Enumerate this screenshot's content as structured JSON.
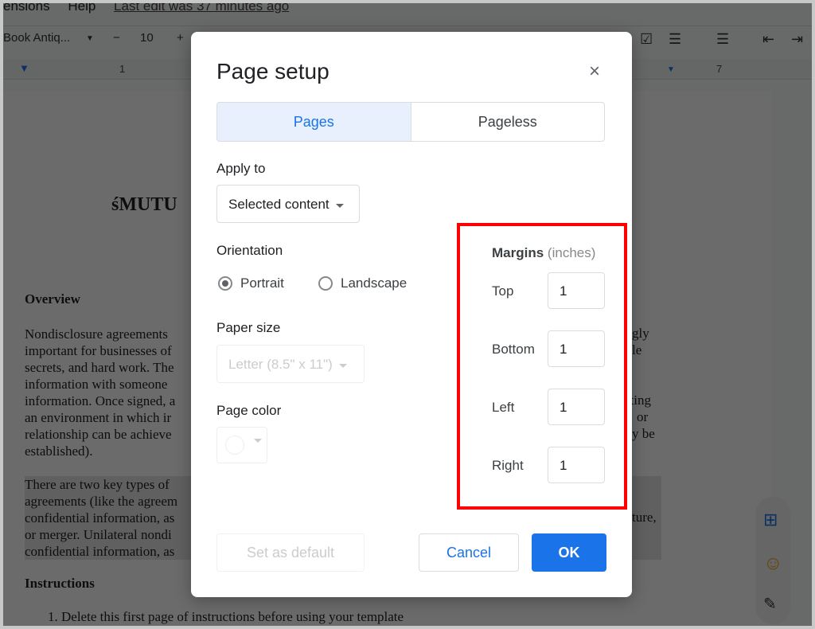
{
  "menubar": {
    "extensions": "ensions",
    "help": "Help",
    "last_edit": "Last edit was 37 minutes ago"
  },
  "toolbar": {
    "font": "Book Antiq...",
    "font_size": "10",
    "minus": "−",
    "plus": "+"
  },
  "ruler": {
    "mark1": "1",
    "mark7": "7"
  },
  "document": {
    "title": "śMUTU",
    "overview_heading": "Overview",
    "para1_left": [
      "Nondisclosure agreements",
      "important for businesses of",
      "secrets, and hard work. The",
      "information with someone",
      "information. Once signed, a",
      "an environment in which ir",
      "relationship can be achieve",
      "established)."
    ],
    "para1_right": [
      "gly",
      "le",
      "",
      "",
      "ating",
      "or",
      "y be",
      ""
    ],
    "para2_left": [
      "There are two key types of",
      "agreements (like the agreem",
      "confidential information, as",
      "or merger. Unilateral nondi",
      "confidential information, as"
    ],
    "para2_right": "ture,",
    "instructions_heading": "Instructions",
    "instruction_1": "1.   Delete this first page of instructions before using your template"
  },
  "dialog": {
    "title": "Page setup",
    "close": "×",
    "tabs": [
      "Pages",
      "Pageless"
    ],
    "apply_to_label": "Apply to",
    "apply_to_value": "Selected content",
    "orientation_label": "Orientation",
    "orientation_options": [
      "Portrait",
      "Landscape"
    ],
    "paper_size_label": "Paper size",
    "paper_size_value": "Letter (8.5\" x 11\")",
    "page_color_label": "Page color",
    "margins_title": "Margins",
    "margins_unit": "(inches)",
    "margins": [
      {
        "label": "Top",
        "value": "1"
      },
      {
        "label": "Bottom",
        "value": "1"
      },
      {
        "label": "Left",
        "value": "1"
      },
      {
        "label": "Right",
        "value": "1"
      }
    ],
    "set_default": "Set as default",
    "cancel": "Cancel",
    "ok": "OK"
  },
  "colors": {
    "accent": "#1a73e8",
    "highlight": "#ff0000"
  }
}
